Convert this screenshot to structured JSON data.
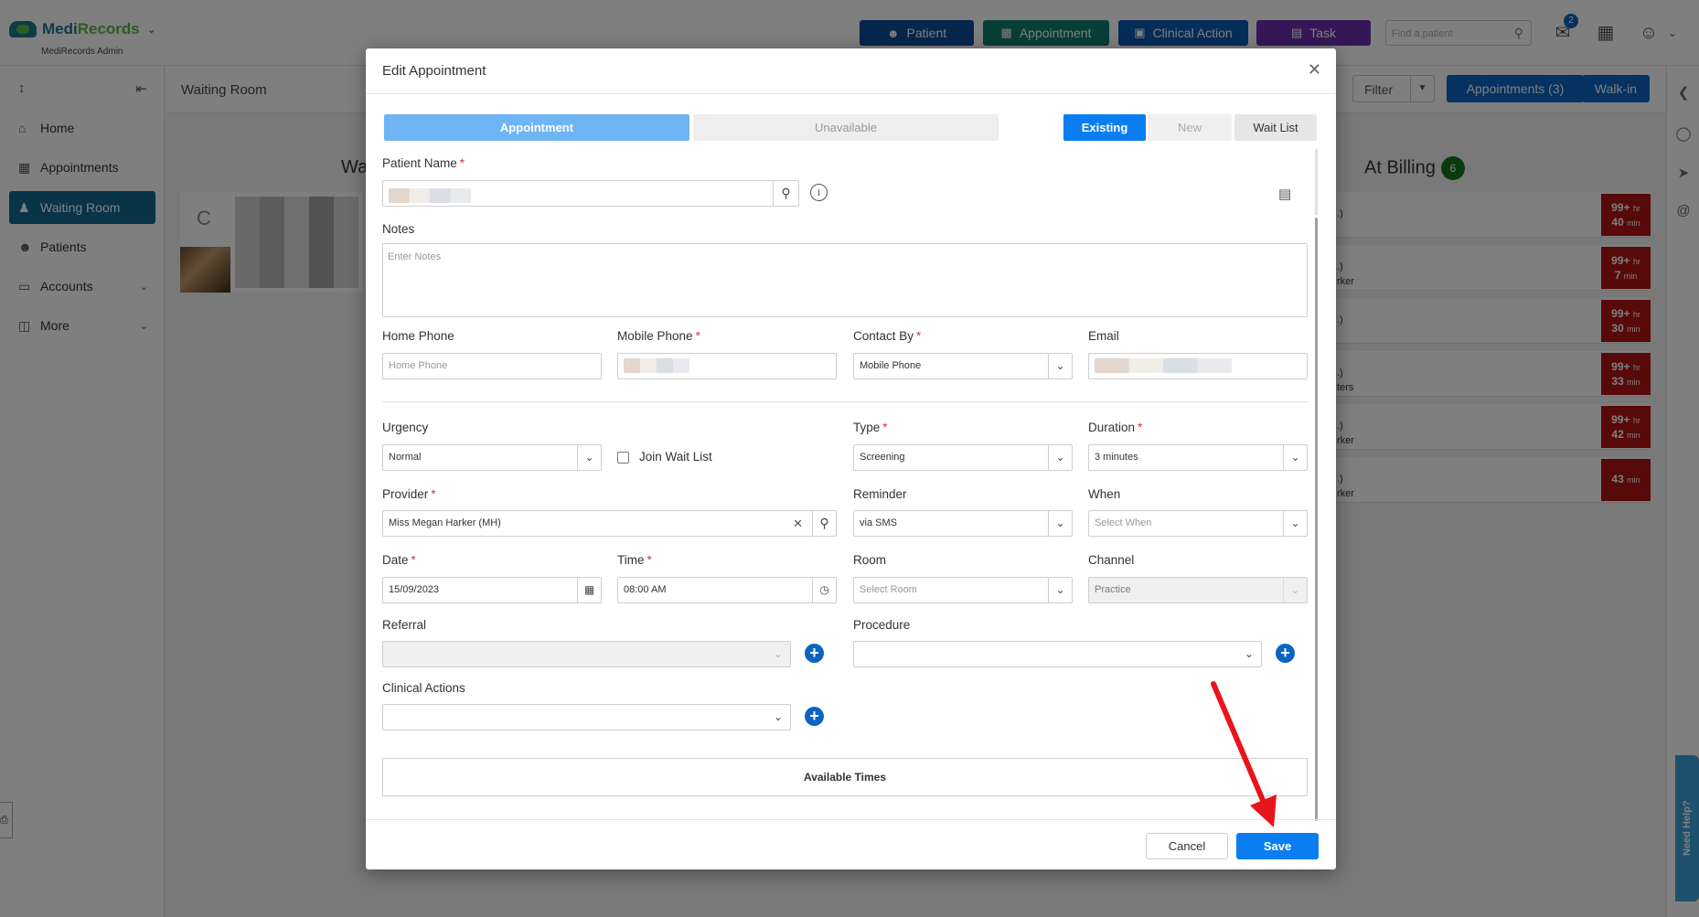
{
  "app": {
    "brand_prefix": "Medi",
    "brand_suffix": "Records",
    "subtitle": "MediRecords Admin"
  },
  "topnav": {
    "buttons": [
      {
        "label": "Patient",
        "icon": "person-add-icon",
        "color": "#0a4c9a"
      },
      {
        "label": "Appointment",
        "icon": "calendar-icon",
        "color": "#0e7d6e"
      },
      {
        "label": "Clinical Action",
        "icon": "medical-kit-icon",
        "color": "#0a5ab5"
      },
      {
        "label": "Task",
        "icon": "clipboard-icon",
        "color": "#6a2fb0"
      }
    ],
    "search_placeholder": "Find a patient",
    "mail_badge": "2"
  },
  "sidebar": {
    "items": [
      {
        "label": "Home",
        "icon": "home-icon"
      },
      {
        "label": "Appointments",
        "icon": "calendar-icon"
      },
      {
        "label": "Waiting Room",
        "icon": "people-icon",
        "active": true
      },
      {
        "label": "Patients",
        "icon": "person-icon"
      },
      {
        "label": "Accounts",
        "icon": "folder-icon"
      },
      {
        "label": "More",
        "icon": "more-icon"
      }
    ]
  },
  "subbar": {
    "title": "Waiting Room",
    "filter_label": "Filter",
    "appointments_label": "Appointments (3)",
    "walkin_label": "Walk-in"
  },
  "board": {
    "waiting_header_partial": "Wa",
    "waiting_initial": "C",
    "billing_header": "At Billing",
    "billing_count": "6",
    "billing_cards": [
      {
        "snippet": ".)",
        "snippet2": "",
        "hr": "99+",
        "min": "40"
      },
      {
        "snippet": ".)",
        "snippet2": "rker",
        "hr": "99+",
        "min": "7"
      },
      {
        "snippet": ".)",
        "snippet2": "",
        "hr": "99+",
        "min": "30"
      },
      {
        "snippet": ".)",
        "snippet2": "ters",
        "hr": "99+",
        "min": "33"
      },
      {
        "snippet": ".)",
        "snippet2": "rker",
        "hr": "99+",
        "min": "42"
      },
      {
        "snippet": ".)",
        "snippet2": "rker",
        "hr": "",
        "min": "43"
      }
    ],
    "hr_unit": "hr",
    "min_unit": "min"
  },
  "need_help": "Need Help?",
  "modal": {
    "title": "Edit Appointment",
    "tabs": [
      "Appointment",
      "Unavailable"
    ],
    "patient_modes": [
      "Existing",
      "New",
      "Wait List"
    ],
    "patient_name_label": "Patient Name",
    "notes_label": "Notes",
    "notes_placeholder": "Enter Notes",
    "home_phone_label": "Home Phone",
    "home_phone_placeholder": "Home Phone",
    "mobile_phone_label": "Mobile Phone",
    "contact_by_label": "Contact By",
    "contact_by_value": "Mobile Phone",
    "email_label": "Email",
    "urgency_label": "Urgency",
    "urgency_value": "Normal",
    "join_wait_list_label": "Join Wait List",
    "type_label": "Type",
    "type_value": "Screening",
    "duration_label": "Duration",
    "duration_value": "3 minutes",
    "provider_label": "Provider",
    "provider_value": "Miss Megan Harker (MH)",
    "reminder_label": "Reminder",
    "reminder_value": "via SMS",
    "when_label": "When",
    "when_placeholder": "Select When",
    "date_label": "Date",
    "date_value": "15/09/2023",
    "time_label": "Time",
    "time_value": "08:00 AM",
    "room_label": "Room",
    "room_placeholder": "Select Room",
    "channel_label": "Channel",
    "channel_value": "Practice",
    "referral_label": "Referral",
    "procedure_label": "Procedure",
    "clinical_actions_label": "Clinical Actions",
    "available_times_label": "Available Times",
    "cancel_label": "Cancel",
    "save_label": "Save"
  },
  "colors": {
    "primary": "#0a7ef0",
    "tab_active": "#6fb4f5",
    "required": "#d9363e",
    "annotation_arrow": "#e8141b"
  }
}
